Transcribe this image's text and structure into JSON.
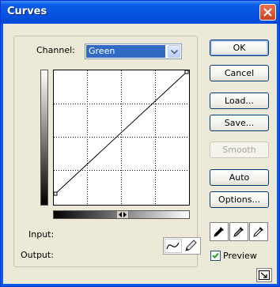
{
  "window": {
    "title": "Curves"
  },
  "channel": {
    "label": "Channel:",
    "value": "Green"
  },
  "info": {
    "input_label": "Input:",
    "output_label": "Output:"
  },
  "buttons": {
    "ok": "OK",
    "cancel": "Cancel",
    "load": "Load...",
    "save": "Save...",
    "smooth": "Smooth",
    "auto": "Auto",
    "options": "Options..."
  },
  "preview": {
    "label": "Preview",
    "checked": true
  },
  "curve": {
    "points": [
      [
        0,
        0
      ],
      [
        255,
        255
      ]
    ]
  },
  "colors": {
    "title_bar": "#0a5de3",
    "selection": "#316ac5",
    "dialog_bg": "#ece9d8"
  },
  "icons": {
    "close": "close-icon",
    "dropdown": "chevron-down-icon",
    "curve_tool": "curve-tool-icon",
    "pencil_tool": "pencil-icon",
    "black_eyedropper": "eyedropper-black-icon",
    "gray_eyedropper": "eyedropper-gray-icon",
    "white_eyedropper": "eyedropper-white-icon",
    "expand": "expand-view-icon"
  }
}
